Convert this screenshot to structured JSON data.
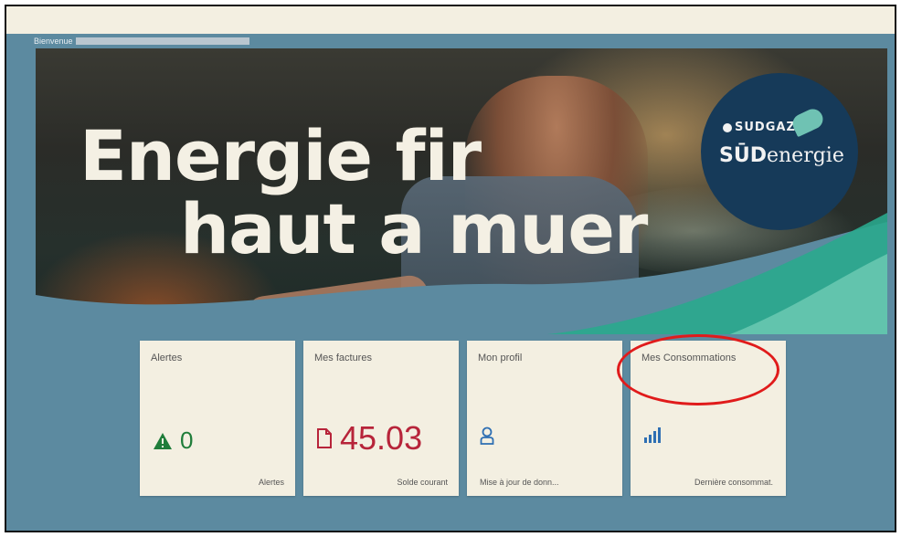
{
  "header": {
    "welcome_label": "Bienvenue"
  },
  "banner": {
    "headline_line1": "Energie fir",
    "headline_line2": "haut a muer",
    "logo_top": "SUDGAZ",
    "logo_brand_bold": "SŪD",
    "logo_brand_rest": "energie"
  },
  "tiles": [
    {
      "title": "Alertes",
      "value": "0",
      "footer": "Alertes",
      "icon": "warning-triangle-icon",
      "color": "#1f7d3a"
    },
    {
      "title": "Mes factures",
      "value": "45.03",
      "footer": "Solde courant",
      "icon": "document-icon",
      "color": "#b7243a"
    },
    {
      "title": "Mon profil",
      "value": "",
      "footer": "Mise à jour de donn...",
      "icon": "user-icon",
      "color": "#2e6fb3"
    },
    {
      "title": "Mes Consommations",
      "value": "",
      "footer": "Dernière consommat.",
      "icon": "bar-chart-icon",
      "color": "#2e6fb3"
    }
  ],
  "highlight": {
    "color": "#e01b1b"
  }
}
